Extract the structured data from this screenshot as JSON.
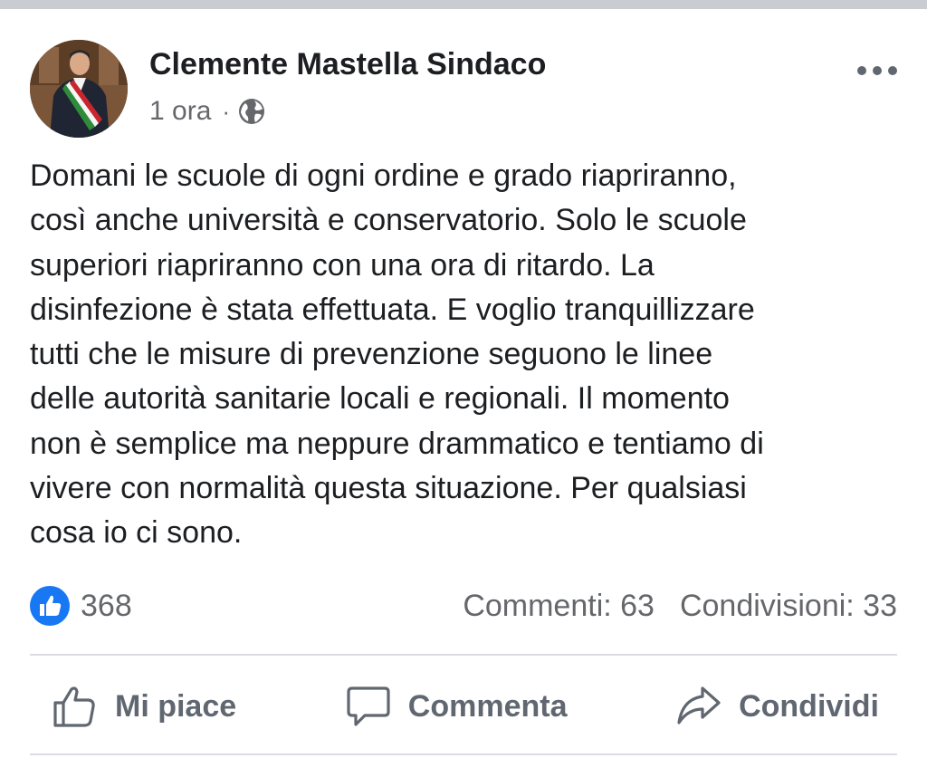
{
  "post": {
    "author": "Clemente Mastella Sindaco",
    "time": "1 ora",
    "separator": "·",
    "audience_icon": "globe-icon",
    "menu_icon": "more-options-icon",
    "text": "Domani le scuole di ogni ordine e grado riapriranno,\ncosì anche università e conservatorio. Solo le scuole\nsuperiori riapriranno con una ora di ritardo. La\ndisinfezione è stata effettuata. E voglio tranquillizzare\ntutti che le misure di prevenzione seguono le linee\ndelle autorità sanitarie locali e regionali. Il momento\nnon è semplice ma neppure drammatico e tentiamo di\nvivere con normalità questa situazione. Per qualsiasi\ncosa io ci sono."
  },
  "stats": {
    "likes": "368",
    "comments": "Commenti: 63",
    "shares": "Condivisioni: 33"
  },
  "actions": {
    "like": "Mi piace",
    "comment": "Commenta",
    "share": "Condividi"
  },
  "colors": {
    "like_blue": "#1877f2",
    "secondary_text": "#65676b",
    "action_text": "#606770",
    "divider": "#dadde1"
  }
}
